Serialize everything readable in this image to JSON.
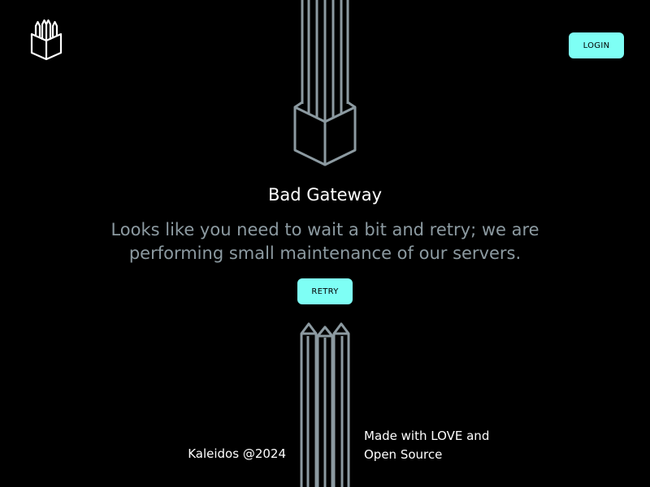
{
  "header": {
    "logo_icon": "penpot-logo-icon",
    "login_label": "LOGIN"
  },
  "main": {
    "title": "Bad Gateway",
    "message": "Looks like you need to wait a bit and retry; we are performing small maintenance of our servers.",
    "retry_label": "RETRY"
  },
  "footer": {
    "copyright": "Kaleidos @2024",
    "made_with_line1": "Made with LOVE and",
    "made_with_line2": "Open Source"
  },
  "colors": {
    "background": "#000000",
    "accent": "#7efff5",
    "muted_text": "#8c9aa1",
    "illustration_stroke": "#8c9aa1"
  }
}
